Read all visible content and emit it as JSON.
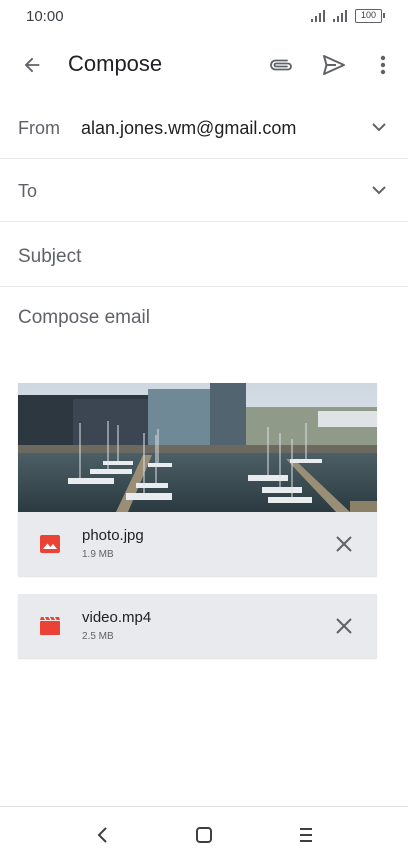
{
  "status_bar": {
    "time": "10:00",
    "battery": "100"
  },
  "app_bar": {
    "title": "Compose"
  },
  "from": {
    "label": "From",
    "value": "alan.jones.wm@gmail.com"
  },
  "to": {
    "label": "To"
  },
  "subject": {
    "placeholder": "Subject"
  },
  "body": {
    "placeholder": "Compose email"
  },
  "attachments": [
    {
      "name": "photo.jpg",
      "size": "1.9 MB",
      "icon": "image-file-icon",
      "icon_color": "#ea4335"
    },
    {
      "name": "video.mp4",
      "size": "2.5 MB",
      "icon": "video-file-icon",
      "icon_color": "#ea4335"
    }
  ],
  "colors": {
    "icon_gray": "#5f6368",
    "attachment_bg": "#e8eaed",
    "accent_red": "#ea4335"
  }
}
